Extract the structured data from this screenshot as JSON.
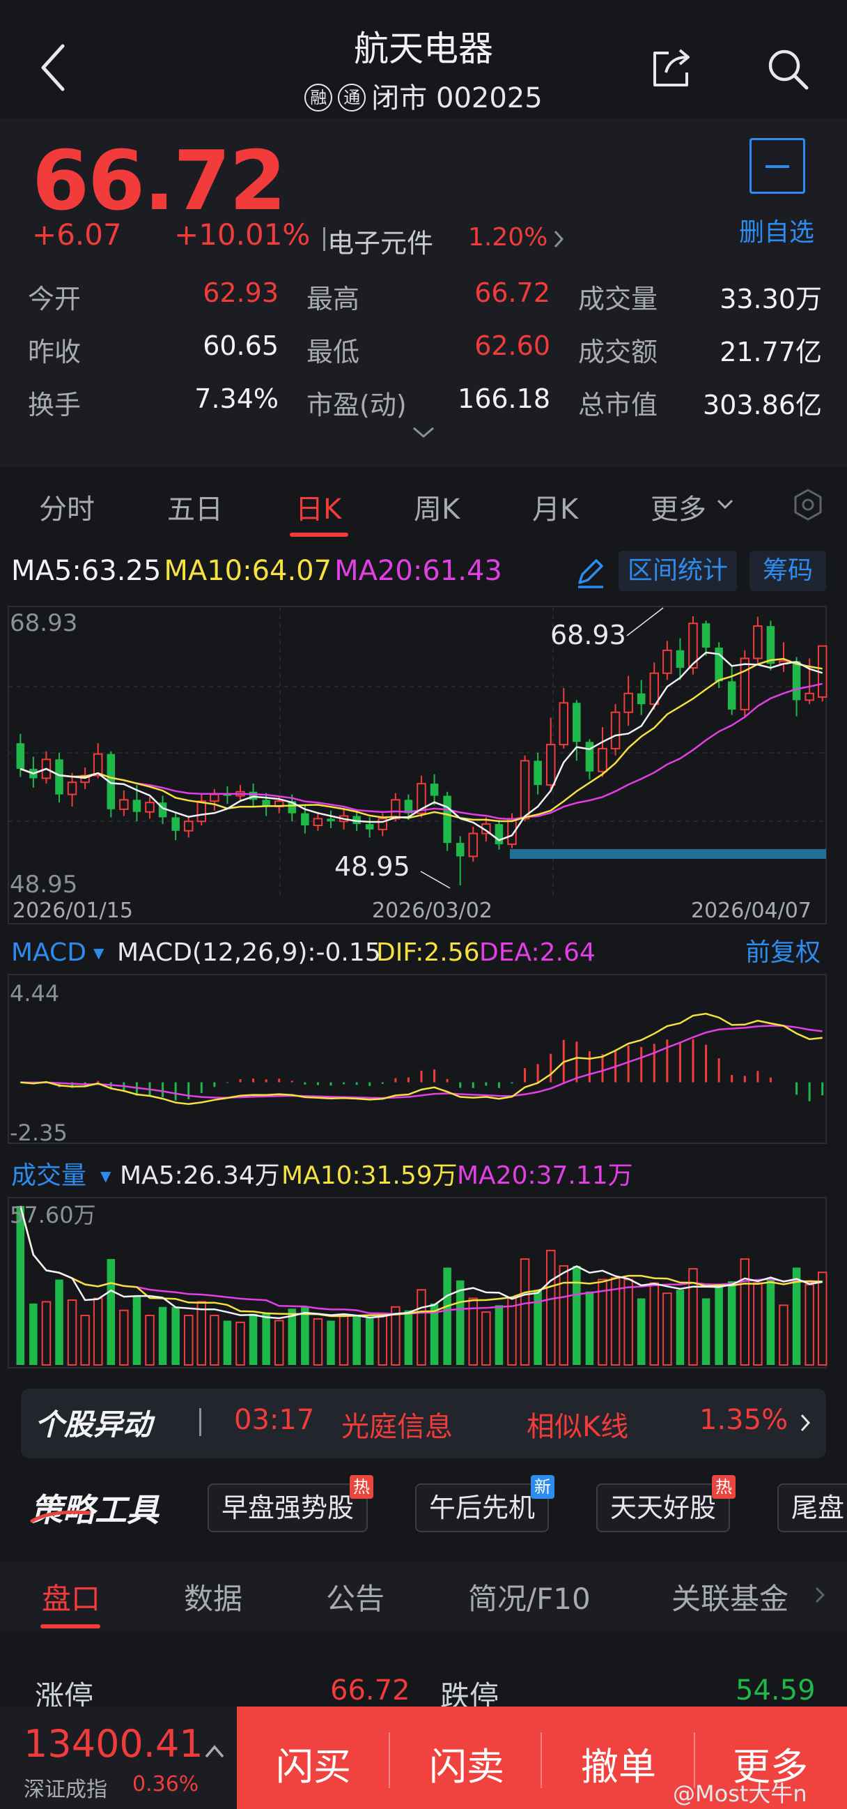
{
  "header": {
    "title": "航天电器",
    "badges": [
      "融",
      "通"
    ],
    "status": "闭市",
    "code": "002025"
  },
  "quote": {
    "price": "66.72",
    "change": "+6.07",
    "change_pct": "+10.01%",
    "sector": "电子元件",
    "sector_pct": "1.20%",
    "fav_label": "删自选",
    "stats": [
      {
        "label": "今开",
        "value": "62.93",
        "color": "red"
      },
      {
        "label": "最高",
        "value": "66.72",
        "color": "red"
      },
      {
        "label": "成交量",
        "value": "33.30万",
        "color": "white"
      },
      {
        "label": "昨收",
        "value": "60.65",
        "color": "white"
      },
      {
        "label": "最低",
        "value": "62.60",
        "color": "red"
      },
      {
        "label": "成交额",
        "value": "21.77亿",
        "color": "white"
      },
      {
        "label": "换手",
        "value": "7.34%",
        "color": "white"
      },
      {
        "label": "市盈(动)",
        "value": "166.18",
        "color": "white"
      },
      {
        "label": "总市值",
        "value": "303.86亿",
        "color": "white"
      }
    ]
  },
  "tabs": [
    "分时",
    "五日",
    "日K",
    "周K",
    "月K",
    "更多"
  ],
  "active_tab": "日K",
  "indicators": {
    "ma5": "MA5:63.25",
    "ma10": "MA10:64.07",
    "ma20": "MA20:61.43",
    "range_btn": "区间统计",
    "chip_btn": "筹码",
    "macd_title": "MACD",
    "macd_params": "MACD(12,26,9):-0.15",
    "dif": "DIF:2.56",
    "dea": "DEA:2.64",
    "adjust": "前复权",
    "vol_title": "成交量",
    "vol_ma5": "MA5:26.34万",
    "vol_ma10": "MA10:31.59万",
    "vol_ma20": "MA20:37.11万"
  },
  "chart_data": {
    "type": "candlestick",
    "price_axis": {
      "max": "68.93",
      "min": "48.95"
    },
    "high_annotation": "68.93",
    "low_annotation": "48.95",
    "dates": [
      "2026/01/15",
      "2026/03/02",
      "2026/04/07"
    ],
    "candles": [
      [
        59.5,
        57.6,
        60.2,
        57.0
      ],
      [
        57.6,
        56.9,
        58.5,
        56.2
      ],
      [
        56.9,
        58.3,
        58.9,
        56.5
      ],
      [
        58.3,
        55.7,
        58.8,
        55.1
      ],
      [
        55.7,
        56.6,
        57.3,
        54.8
      ],
      [
        56.6,
        57.1,
        57.7,
        56.1
      ],
      [
        57.1,
        58.7,
        59.5,
        56.9
      ],
      [
        58.7,
        54.6,
        58.9,
        54.0
      ],
      [
        54.6,
        55.3,
        56.0,
        54.1
      ],
      [
        55.3,
        54.4,
        56.4,
        53.7
      ],
      [
        54.4,
        55.1,
        55.5,
        53.9
      ],
      [
        55.1,
        54.0,
        55.6,
        53.5
      ],
      [
        54.0,
        53.0,
        54.4,
        52.3
      ],
      [
        53.0,
        53.7,
        54.1,
        52.5
      ],
      [
        53.7,
        55.2,
        55.8,
        53.4
      ],
      [
        55.2,
        55.7,
        56.1,
        54.5
      ],
      [
        55.7,
        55.6,
        56.3,
        55.0
      ],
      [
        55.6,
        55.9,
        56.4,
        55.2
      ],
      [
        55.9,
        55.3,
        56.5,
        54.8
      ],
      [
        55.3,
        54.8,
        55.8,
        54.1
      ],
      [
        54.8,
        55.2,
        55.6,
        54.3
      ],
      [
        55.2,
        54.3,
        55.7,
        53.7
      ],
      [
        54.3,
        53.4,
        54.9,
        52.8
      ],
      [
        53.4,
        53.9,
        54.4,
        53.0
      ],
      [
        53.9,
        53.7,
        54.5,
        53.2
      ],
      [
        53.7,
        54.1,
        54.7,
        53.1
      ],
      [
        54.1,
        53.5,
        54.6,
        53.0
      ],
      [
        53.5,
        53.1,
        54.0,
        52.5
      ],
      [
        53.1,
        53.9,
        54.3,
        52.6
      ],
      [
        53.9,
        55.3,
        55.8,
        53.7
      ],
      [
        55.3,
        54.3,
        55.7,
        53.8
      ],
      [
        54.3,
        56.5,
        57.1,
        54.0
      ],
      [
        56.5,
        55.6,
        57.2,
        54.9
      ],
      [
        55.6,
        52.1,
        55.9,
        51.5
      ],
      [
        52.1,
        51.1,
        52.6,
        48.95
      ],
      [
        51.1,
        52.8,
        53.3,
        50.7
      ],
      [
        52.8,
        53.5,
        54.0,
        52.2
      ],
      [
        53.5,
        52.0,
        53.8,
        51.6
      ],
      [
        52.0,
        53.9,
        54.3,
        51.7
      ],
      [
        53.9,
        58.2,
        58.6,
        53.7
      ],
      [
        58.2,
        56.4,
        58.8,
        55.7
      ],
      [
        56.4,
        59.4,
        61.4,
        56.0
      ],
      [
        59.4,
        62.5,
        63.6,
        59.1
      ],
      [
        62.5,
        59.6,
        62.7,
        58.2
      ],
      [
        59.6,
        57.4,
        59.8,
        56.8
      ],
      [
        57.4,
        59.1,
        60.7,
        57.0
      ],
      [
        59.1,
        61.8,
        62.4,
        58.6
      ],
      [
        61.8,
        63.2,
        64.5,
        60.8
      ],
      [
        63.2,
        62.4,
        64.2,
        61.6
      ],
      [
        62.4,
        64.7,
        65.5,
        62.0
      ],
      [
        64.7,
        66.4,
        67.1,
        64.2
      ],
      [
        66.4,
        65.1,
        67.3,
        64.2
      ],
      [
        65.1,
        68.4,
        68.93,
        64.6
      ],
      [
        68.4,
        66.6,
        68.6,
        66.0
      ],
      [
        66.6,
        64.1,
        67.0,
        63.6
      ],
      [
        64.1,
        62.0,
        65.2,
        61.6
      ],
      [
        62.0,
        65.8,
        66.4,
        61.5
      ],
      [
        65.8,
        68.2,
        68.9,
        65.4
      ],
      [
        68.2,
        65.4,
        68.6,
        64.9
      ],
      [
        65.4,
        65.6,
        67.0,
        64.8
      ],
      [
        65.6,
        62.7,
        65.9,
        61.5
      ],
      [
        62.7,
        63.2,
        65.8,
        62.4
      ],
      [
        62.93,
        66.72,
        66.72,
        62.6
      ]
    ],
    "macd_axis": {
      "max": "4.44",
      "min": "-2.35"
    },
    "volume_axis": {
      "max": "57.60万"
    }
  },
  "alert": {
    "logo": "个股异动",
    "time": "03:17",
    "name": "光庭信息",
    "pattern": "相似K线",
    "pct": "1.35%"
  },
  "strategy": {
    "logo": "策略工具",
    "items": [
      {
        "label": "早盘强势股",
        "tag": "热",
        "tag_color": "#e8463f"
      },
      {
        "label": "午后先机",
        "tag": "新",
        "tag_color": "#2d8cf0"
      },
      {
        "label": "天天好股",
        "tag": "热",
        "tag_color": "#e8463f"
      },
      {
        "label": "尾盘",
        "tag": "",
        "tag_color": ""
      }
    ]
  },
  "panel_tabs": [
    "盘口",
    "数据",
    "公告",
    "简况/F10",
    "关联基金"
  ],
  "limits": {
    "up_label": "涨停",
    "up_value": "66.72",
    "down_label": "跌停",
    "down_value": "54.59"
  },
  "footer": {
    "index_value": "13400.41",
    "index_name": "深证成指",
    "index_pct": "0.36%",
    "buttons": [
      "闪买",
      "闪卖",
      "撤单",
      "更多"
    ],
    "watermark": "@Most大牛n"
  }
}
